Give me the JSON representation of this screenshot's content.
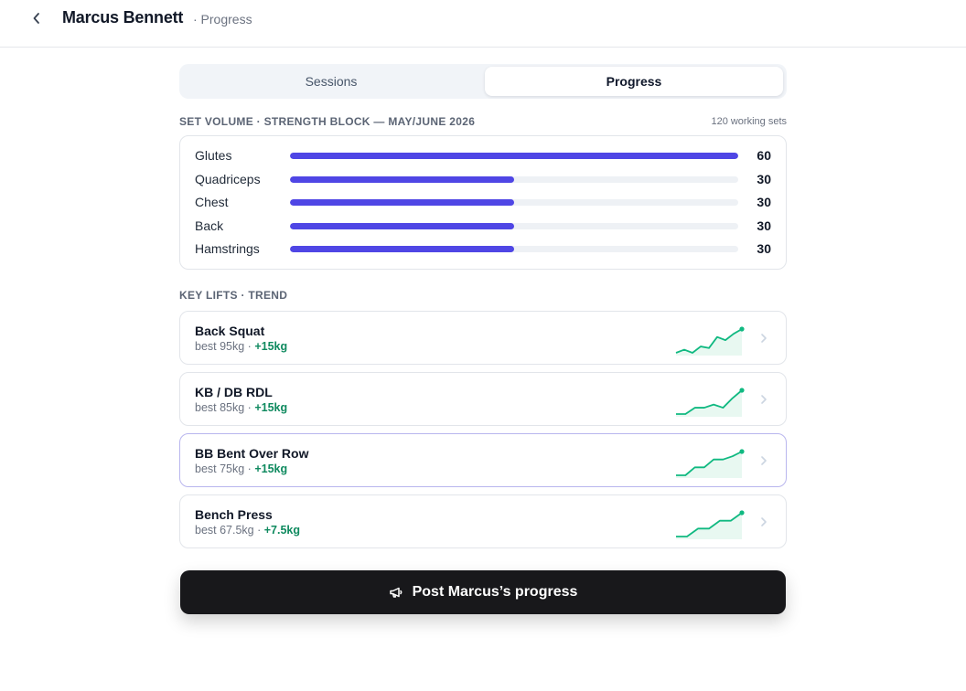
{
  "header": {
    "title": "Marcus Bennett",
    "subtitle": "· Progress"
  },
  "tabs": [
    {
      "label": "Sessions",
      "active": false
    },
    {
      "label": "Progress",
      "active": true
    }
  ],
  "volume": {
    "title": "SET VOLUME · STRENGTH BLOCK — MAY/JUNE 2026",
    "meta": "120 working sets",
    "max": 60,
    "rows": [
      {
        "label": "Glutes",
        "value": 60,
        "display": "60"
      },
      {
        "label": "Quadriceps",
        "value": 30,
        "display": "30"
      },
      {
        "label": "Chest",
        "value": 30,
        "display": "30"
      },
      {
        "label": "Back",
        "value": 30,
        "display": "30"
      },
      {
        "label": "Hamstrings",
        "value": 30,
        "display": "30"
      }
    ]
  },
  "lifts": {
    "title": "KEY LIFTS · TREND",
    "items": [
      {
        "name": "Back Squat",
        "best": "best 95kg ·",
        "delta": "+15kg",
        "trend": [
          80,
          82,
          80,
          84,
          83,
          90,
          88,
          92,
          95
        ]
      },
      {
        "name": "KB / DB RDL",
        "best": "best 85kg ·",
        "delta": "+15kg",
        "trend": [
          70,
          70,
          74,
          74,
          76,
          74,
          80,
          85
        ]
      },
      {
        "name": "BB Bent Over Row",
        "best": "best 75kg ·",
        "delta": "+15kg",
        "trend": [
          60,
          60,
          65,
          65,
          70,
          70,
          72,
          75
        ]
      },
      {
        "name": "Bench Press",
        "best": "best 67.5kg ·",
        "delta": "+7.5kg",
        "trend": [
          60,
          60,
          62.5,
          62.5,
          65,
          65,
          67.5
        ]
      }
    ]
  },
  "selected_lift_index": 2,
  "colors": {
    "accent": "#4f46e5",
    "trend": "#10b981",
    "trend_fill": "#e8f8f1",
    "button": "#18181b"
  },
  "post_button": {
    "label": "Post Marcus’s progress",
    "icon": "megaphone-icon"
  }
}
